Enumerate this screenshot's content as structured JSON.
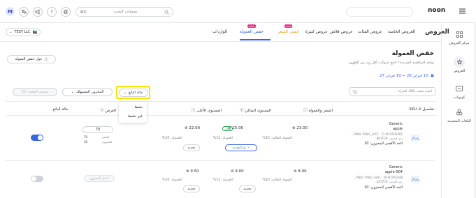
{
  "topbar": {
    "avatar_initial": "M",
    "search_placeholder": "صفحات البحث",
    "logo_text": "noon",
    "menu_icon": "hamburger-icon"
  },
  "sidebar": {
    "items": [
      {
        "label": "مركز العروض",
        "icon": "grid-icon"
      },
      {
        "label": "العروض",
        "icon": "offers-icon"
      },
      {
        "label": "كوبونات",
        "icon": "coupon-icon"
      },
      {
        "label": "الباقات المتقدمة",
        "icon": "bundle-icon"
      }
    ]
  },
  "nav": {
    "title": "العروض",
    "tabs": [
      {
        "label": "العروض الخاصة"
      },
      {
        "label": "عروض الفئات"
      },
      {
        "label": "عروض فلاش"
      },
      {
        "label": "عروض كبيرة"
      },
      {
        "label": "خفض السعر",
        "badge": "جديد"
      },
      {
        "label": "خفض العمولة",
        "badge": "جديد"
      },
      {
        "label": "الواردات"
      }
    ],
    "store": "TEST LLC"
  },
  "page": {
    "title": "خفض العمولة",
    "subtitle": "تواجه المنافسة الشديدة؟ ادفع عمولات أقل وزد من الظهور.",
    "date_range": "10 فبراير 26  ←  10 فبراير 27",
    "about_button": "حول خفض العمولة"
  },
  "filters": {
    "search_placeholder": "ابحث حسب SKU، المارك...",
    "status_dropdown": "حالة البائع",
    "stock_dropdown": "المخزون المستهلك",
    "update_button": "تحديث المحدد (0)",
    "status_options": [
      "نشط",
      "غير نشط"
    ]
  },
  "table": {
    "headers": {
      "sku": "تفاصيل الـ SKU",
      "price": "السعر والعمولة",
      "optimal": "المستوى المثالي",
      "ideal": "المستوى الأعلى",
      "offer": "العرض",
      "seller_status": "حالة البائع"
    },
    "rows": [
      {
        "brand": "Generic",
        "name": "apple",
        "ids": "PSKU: PSKU_1e57...73 N17ACD491...",
        "meta": "رمز العرض: 8D7F5B...",
        "stock": "الحد الأقصى للمخزون: 10",
        "price": "23.00",
        "commission_current": "العمولة الحالية: 15%",
        "optimal_price": "25.00",
        "optimal_badge": "مثالي",
        "optimal_commission": "العمولة: 12%",
        "optimal_action": "تم التحديد",
        "ideal_price": "22.00",
        "ideal_commission": "العمولة: 10%",
        "ideal_action": "تحديد",
        "offer_value": "70",
        "offer_note1": "السعر",
        "offer_note2": "المخزون",
        "offer_val1": "70",
        "offer_val2": "10",
        "active": true
      },
      {
        "brand": "Generic",
        "name": "apple-004",
        "ids": "PSKU: PSKU_1e61...58 N17ACE48...",
        "meta": "رمز العرض: 4A57C8...",
        "stock": "الحد الأقصى للمخزون: 10",
        "price": "8.00",
        "commission_current": "العمولة الحالية: 15%",
        "optimal_price": "9.00",
        "optimal_commission": "العمولة: 12%",
        "optimal_action": "تحديد",
        "ideal_price": "9.50",
        "ideal_commission": "العمولة: 10%",
        "ideal_action": "تحديد",
        "offer_placeholder": "أدخل المخزون",
        "active": false
      }
    ]
  },
  "colors": {
    "accent": "#3866df",
    "highlight": "#f7e600",
    "badge_new": "#e6368a",
    "toggle_on": "#3866df",
    "toggle_off": "#cfd3d9",
    "optimal_green": "#2fa55a"
  }
}
